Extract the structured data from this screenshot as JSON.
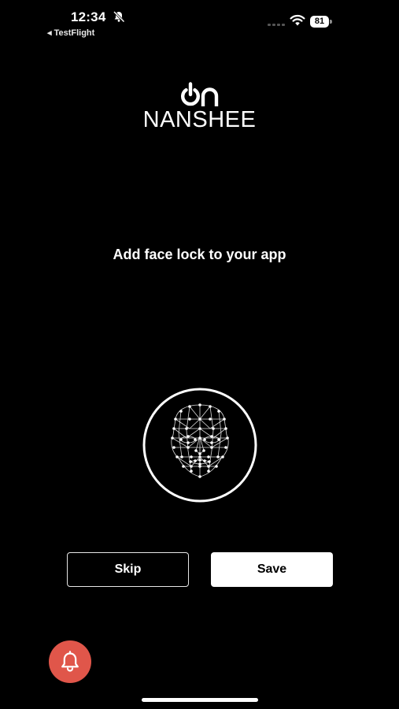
{
  "status_bar": {
    "time": "12:34",
    "back_app": "◂ TestFlight",
    "battery": "81"
  },
  "brand": {
    "name": "NANSHEE",
    "logo_icon": "power-on-logo"
  },
  "headline": "Add face lock to your app",
  "buttons": {
    "skip_label": "Skip",
    "save_label": "Save"
  },
  "icons": {
    "mute": "bell-slash-icon",
    "wifi": "wifi-icon",
    "face": "face-mesh-icon",
    "notification": "bell-icon"
  },
  "colors": {
    "background": "#000000",
    "fab": "#e0564a"
  }
}
